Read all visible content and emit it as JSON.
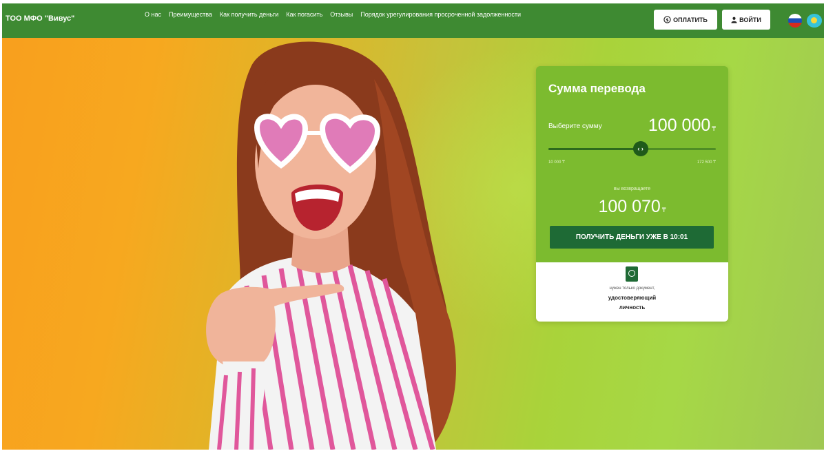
{
  "brand": "ТОО МФО \"Вивус\"",
  "nav": [
    {
      "label": "О нас"
    },
    {
      "label": "Преимущества"
    },
    {
      "label": "Как получить деньги"
    },
    {
      "label": "Как погасить"
    },
    {
      "label": "Отзывы"
    },
    {
      "label": "Порядок урегулирования просроченной задолженности"
    }
  ],
  "buttons": {
    "pay_label": "ОПЛАТИТЬ",
    "login_label": "ВОЙТИ"
  },
  "languages": [
    "ru",
    "kz"
  ],
  "card": {
    "title": "Сумма перевода",
    "choose_label": "Выберите сумму",
    "amount": "100 000",
    "currency": "₸",
    "slider": {
      "min_label": "10 000 ₸",
      "max_label": "172 500 ₸",
      "value_fraction": 0.55
    },
    "return_label": "вы возвращаете",
    "return_amount": "100 070",
    "get_button": "ПОЛУЧИТЬ ДЕНЬГИ УЖЕ В 10:01",
    "doc_line1": "нужен только документ,",
    "doc_line2": "удостоверяющий",
    "doc_line3": "личность"
  },
  "colors": {
    "nav_bg": "#3e8a32",
    "card_green": "#7cbb2f",
    "button_green": "#1e6a35",
    "accent_orange": "#f89f1e",
    "accent_lime": "#a6d846"
  },
  "icons": {
    "pay": "money-circle-icon",
    "login": "user-icon",
    "slider_thumb": "arrows-left-right-icon",
    "document": "passport-icon"
  }
}
